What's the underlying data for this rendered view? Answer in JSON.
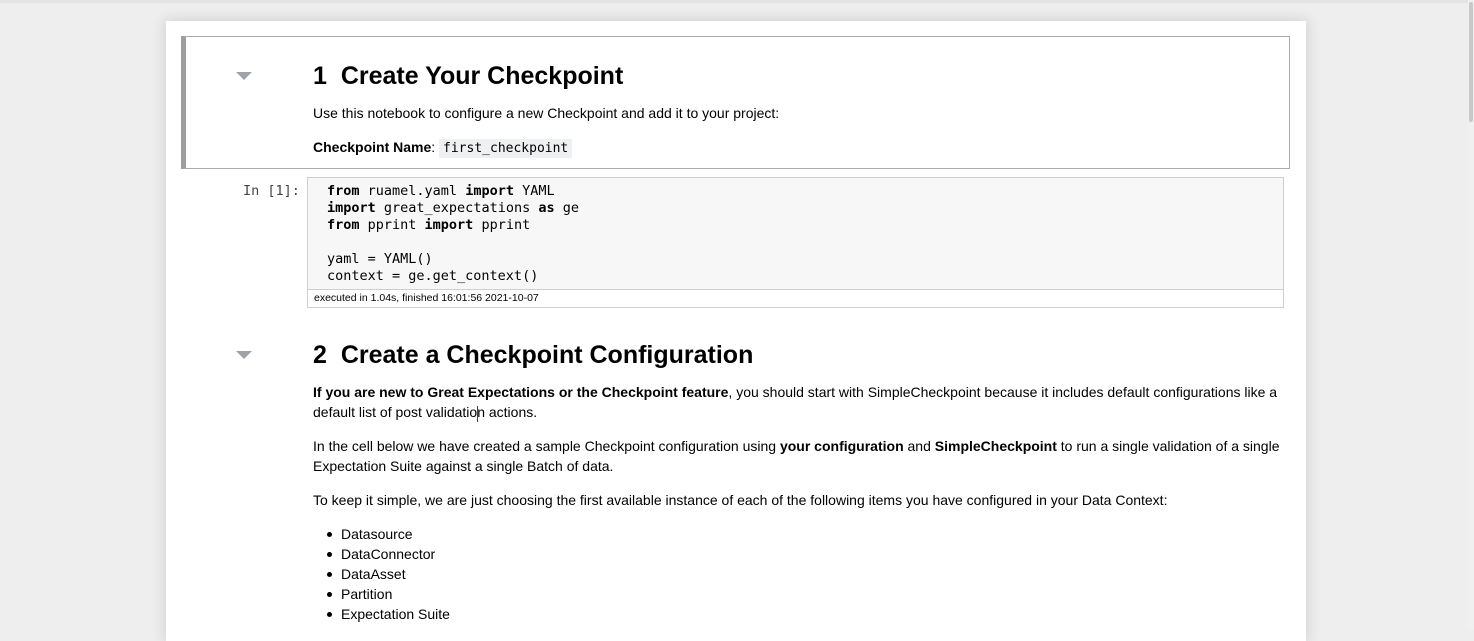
{
  "cells": {
    "md1": {
      "heading_number": "1",
      "heading_text": "Create Your Checkpoint",
      "intro": "Use this notebook to configure a new Checkpoint and add it to your project:",
      "name_label": "Checkpoint Name",
      "name_colon": ":",
      "name_value": "first_checkpoint"
    },
    "code1": {
      "prompt": "In [1]:",
      "lines": [
        {
          "k1": "from",
          "t1": " ruamel.yaml ",
          "k2": "import",
          "t2": " YAML"
        },
        {
          "k1": "import",
          "t1": " great_expectations ",
          "k2": "as",
          "t2": " ge"
        },
        {
          "k1": "from",
          "t1": " pprint ",
          "k2": "import",
          "t2": " pprint"
        },
        {
          "t0": "yaml = YAML()"
        },
        {
          "t0": "context = ge.get_context()"
        }
      ],
      "exec_info": "executed in 1.04s, finished 16:01:56 2021-10-07"
    },
    "md2": {
      "heading_number": "2",
      "heading_text": "Create a Checkpoint Configuration",
      "p1_bold": "If you are new to Great Expectations or the Checkpoint feature",
      "p1_rest": ", you should start with SimpleCheckpoint because it includes default configurations like a default list of post validation actions.",
      "p2_a": "In the cell below we have created a sample Checkpoint configuration using ",
      "p2_b": "your configuration",
      "p2_c": " and ",
      "p2_d": "SimpleCheckpoint",
      "p2_e": " to run a single validation of a single Expectation Suite against a single Batch of data.",
      "p3": "To keep it simple, we are just choosing the first available instance of each of the following items you have configured in your Data Context:",
      "items": [
        "Datasource",
        "DataConnector",
        "DataAsset",
        "Partition",
        "Expectation Suite"
      ]
    }
  },
  "icons": {
    "collapse": "caret-down-icon"
  }
}
